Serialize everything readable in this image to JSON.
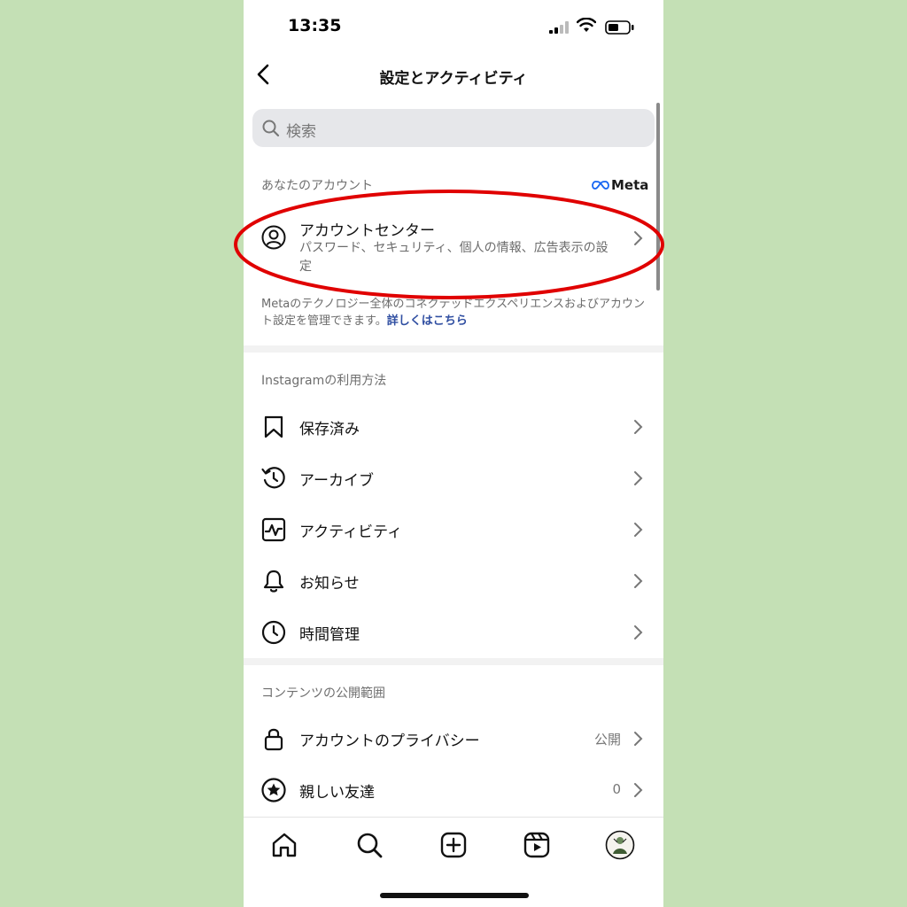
{
  "status_bar": {
    "time": "13:35"
  },
  "nav": {
    "title": "設定とアクティビティ"
  },
  "search": {
    "placeholder": "検索"
  },
  "account_section": {
    "header": "あなたのアカウント",
    "meta_logo": "Meta",
    "account_center": {
      "title": "アカウントセンター",
      "subtitle": "パスワード、セキュリティ、個人の情報、広告表示の設定"
    },
    "description": "Metaのテクノロジー全体のコネクテッドエクスペリエンスおよびアカウント設定を管理できます。",
    "learn_more": "詳しくはこちら"
  },
  "usage_section": {
    "header": "Instagramの利用方法",
    "items": [
      {
        "label": "保存済み",
        "icon": "bookmark-icon"
      },
      {
        "label": "アーカイブ",
        "icon": "archive-icon"
      },
      {
        "label": "アクティビティ",
        "icon": "activity-icon"
      },
      {
        "label": "お知らせ",
        "icon": "bell-icon"
      },
      {
        "label": "時間管理",
        "icon": "clock-icon"
      }
    ]
  },
  "visibility_section": {
    "header": "コンテンツの公開範囲",
    "items": [
      {
        "label": "アカウントのプライバシー",
        "value": "公開",
        "icon": "lock-icon"
      },
      {
        "label": "親しい友達",
        "value": "0",
        "icon": "star-icon"
      }
    ]
  },
  "tab_bar": [
    "home-icon",
    "search-icon",
    "create-icon",
    "reels-icon",
    "profile-avatar"
  ],
  "colors": {
    "highlight_ellipse": "#e00000",
    "link": "#2f4ea1",
    "outer_background": "#c4e0b5"
  }
}
